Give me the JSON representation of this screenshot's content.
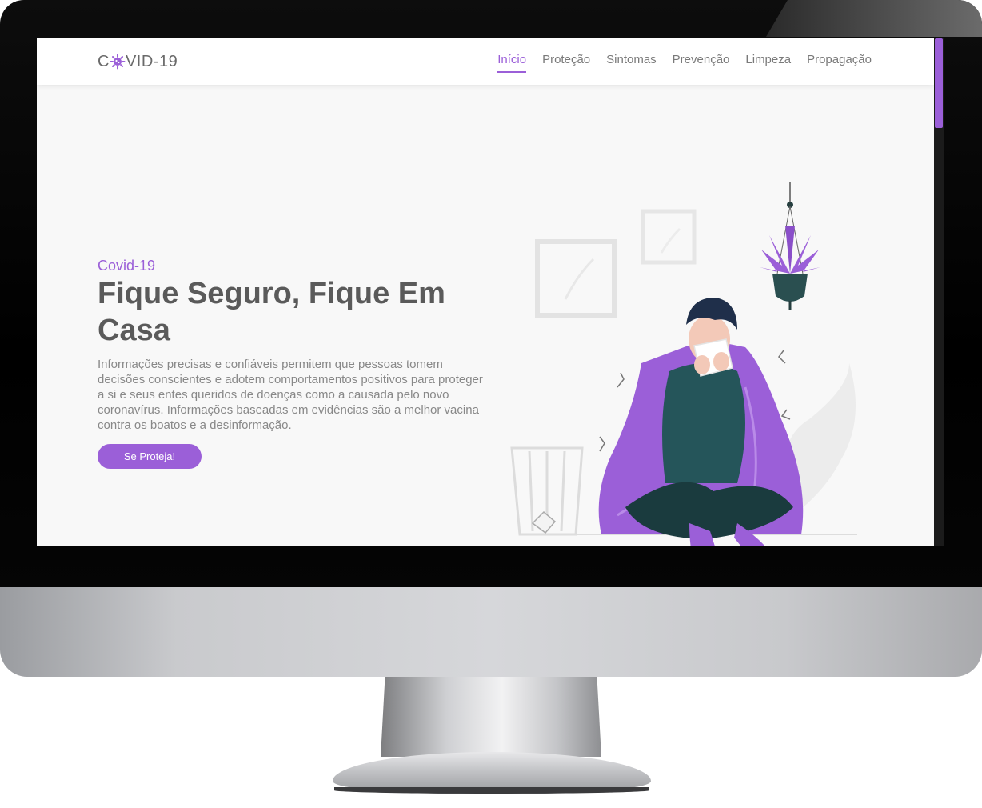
{
  "brand": {
    "logo_prefix": "C",
    "logo_suffix": "VID-19",
    "accent_color": "#9b5fd8"
  },
  "nav": {
    "items": [
      {
        "label": "Início",
        "active": true
      },
      {
        "label": "Proteção",
        "active": false
      },
      {
        "label": "Sintomas",
        "active": false
      },
      {
        "label": "Prevenção",
        "active": false
      },
      {
        "label": "Limpeza",
        "active": false
      },
      {
        "label": "Propagação",
        "active": false
      }
    ]
  },
  "hero": {
    "eyebrow": "Covid-19",
    "title": "Fique Seguro, Fique Em Casa",
    "description": "Informações precisas e confiáveis permitem que pessoas tomem decisões conscientes e adotem comportamentos positivos para proteger a si e seus entes queridos de doenças como a causada pelo novo coronavírus. Informações baseadas em evidências são a melhor vacina contra os boatos e a desinformação.",
    "cta_label": "Se Proteja!"
  },
  "icons": {
    "logo_icon": "virus-icon",
    "illustration": "sick-person-sneezing-illustration"
  }
}
